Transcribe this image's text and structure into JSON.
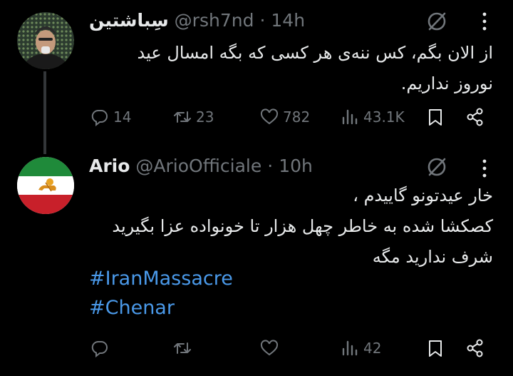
{
  "tweet1": {
    "display_name": "سِباشتین",
    "handle": "@rsh7nd",
    "separator": "·",
    "time": "14h",
    "text_lines": [
      "از الان بگم، کس ننه‌ی هر کسی که بگه امسال عید",
      "نوروز نداریم."
    ],
    "actions": {
      "reply_count": "14",
      "retweet_count": "23",
      "like_count": "782",
      "views_count": "43.1K"
    }
  },
  "tweet2": {
    "display_name": "Ario",
    "handle": "@ArioOfficiale",
    "separator": "·",
    "time": "10h",
    "text_lines": [
      "خار عیدتونو گاییدم ،",
      "کصکشا شده به خاطر چهل هزار تا خونواده عزا بگیرید",
      "شرف ندارید مگه"
    ],
    "hashtags": [
      "#IranMassacre",
      "#Chenar"
    ],
    "actions": {
      "views_count": "42"
    }
  },
  "colors": {
    "background": "#000000",
    "text": "#e7e9ea",
    "muted": "#71767b",
    "link": "#4a99e9",
    "thread_line": "#333639"
  },
  "icons": [
    "grok-icon",
    "more-icon",
    "reply-icon",
    "retweet-icon",
    "like-icon",
    "views-icon",
    "bookmark-icon",
    "share-icon",
    "avatar-user-photo",
    "avatar-lion-sun-flag"
  ]
}
